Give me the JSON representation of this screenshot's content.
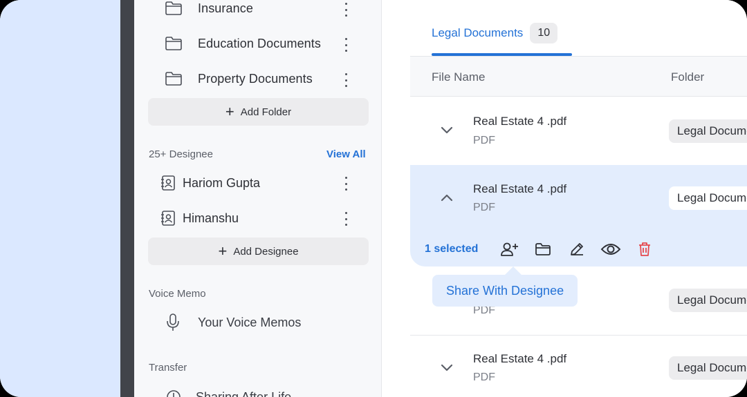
{
  "sidebar": {
    "folders": [
      {
        "label": "Insurance"
      },
      {
        "label": "Education Documents"
      },
      {
        "label": "Property Documents"
      }
    ],
    "add_folder_label": "Add Folder",
    "designee_heading": "25+ Designee",
    "view_all_label": "View All",
    "designees": [
      {
        "label": "Hariom Gupta"
      },
      {
        "label": "Himanshu"
      }
    ],
    "add_designee_label": "Add Designee",
    "voice_memo_heading": "Voice Memo",
    "voice_memo_item": "Your Voice Memos",
    "transfer_heading": "Transfer",
    "transfer_item": "Sharing After Life"
  },
  "main": {
    "tab": {
      "label": "Legal Documents",
      "count": "10"
    },
    "columns": [
      "File Name",
      "Folder"
    ],
    "rows": [
      {
        "file_name": "Real Estate 4 .pdf",
        "file_type": "PDF",
        "folder": "Legal Documents",
        "expanded": false
      },
      {
        "file_name": "Real Estate 4 .pdf",
        "file_type": "PDF",
        "folder": "Legal Documents",
        "expanded": true
      },
      {
        "file_name": "",
        "file_type": "PDF",
        "folder": "Legal Documents",
        "expanded": false
      },
      {
        "file_name": "Real Estate 4 .pdf",
        "file_type": "PDF",
        "folder": "Legal Documents",
        "expanded": false
      }
    ],
    "selection": {
      "count_label": "1 selected",
      "actions": [
        "add-user-icon",
        "folder-icon",
        "pencil-icon",
        "eye-icon",
        "trash-icon"
      ]
    },
    "tooltip": "Share With Designee"
  },
  "colors": {
    "accent": "#2472d6",
    "selected_bg": "#e3edfd",
    "danger": "#e5484d",
    "left_background": "#dbe8ff",
    "dark_strip": "#41444a"
  }
}
